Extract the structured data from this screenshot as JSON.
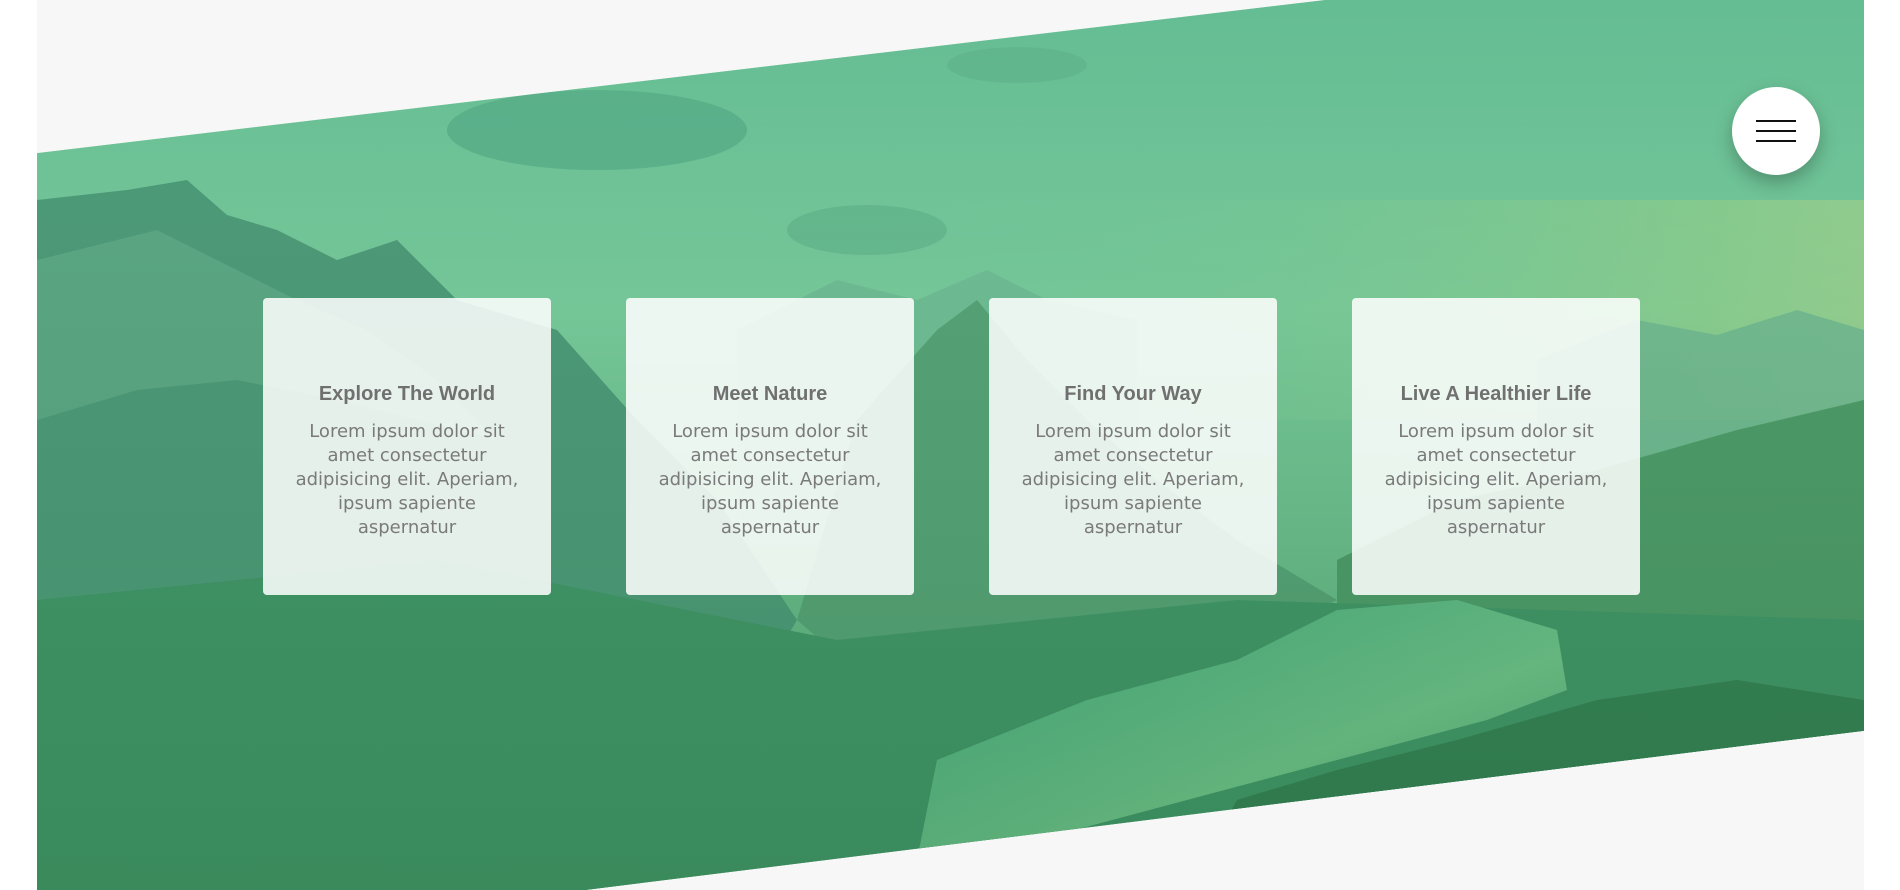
{
  "menu": {
    "icon": "hamburger-menu-icon"
  },
  "hero": {
    "background": "mountain-lake-landscape",
    "overlay_color": "#4fbf86"
  },
  "cards": [
    {
      "title": "Explore The World",
      "text": "Lorem ipsum dolor sit amet consectetur adipisicing elit. Aperiam, ipsum sapiente aspernatur"
    },
    {
      "title": "Meet Nature",
      "text": "Lorem ipsum dolor sit amet consectetur adipisicing elit. Aperiam, ipsum sapiente aspernatur"
    },
    {
      "title": "Find Your Way",
      "text": "Lorem ipsum dolor sit amet consectetur adipisicing elit. Aperiam, ipsum sapiente aspernatur"
    },
    {
      "title": "Live A Healthier Life",
      "text": "Lorem ipsum dolor sit amet consectetur adipisicing elit. Aperiam, ipsum sapiente aspernatur"
    }
  ]
}
